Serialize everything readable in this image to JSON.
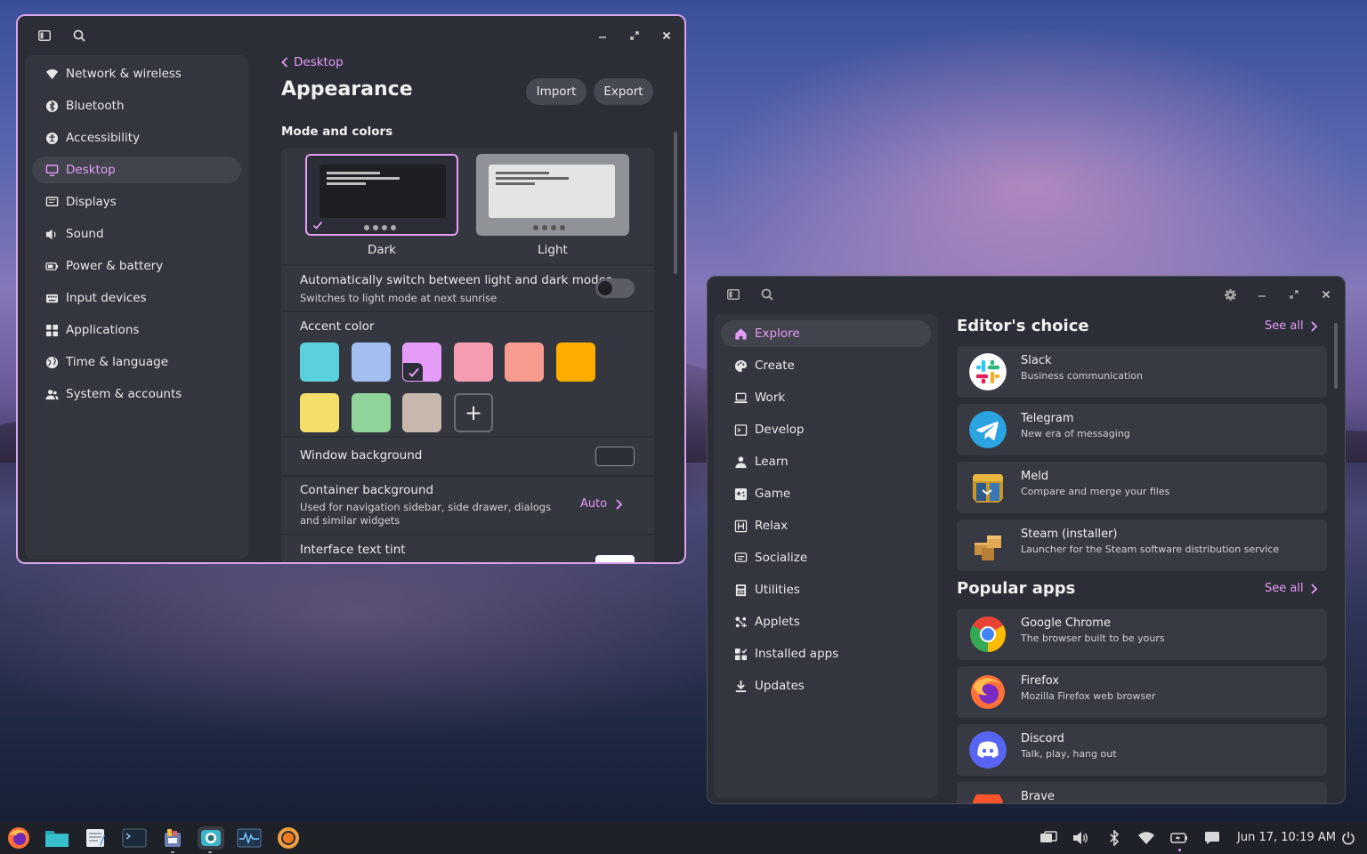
{
  "settings_window": {
    "sidebar": [
      {
        "label": "Network & wireless",
        "icon": "wifi-icon"
      },
      {
        "label": "Bluetooth",
        "icon": "bluetooth-icon"
      },
      {
        "label": "Accessibility",
        "icon": "accessibility-icon"
      },
      {
        "label": "Desktop",
        "icon": "desktop-icon",
        "active": true
      },
      {
        "label": "Displays",
        "icon": "displays-icon"
      },
      {
        "label": "Sound",
        "icon": "sound-icon"
      },
      {
        "label": "Power & battery",
        "icon": "battery-icon"
      },
      {
        "label": "Input devices",
        "icon": "keyboard-icon"
      },
      {
        "label": "Applications",
        "icon": "applications-icon"
      },
      {
        "label": "Time & language",
        "icon": "globe-icon"
      },
      {
        "label": "System & accounts",
        "icon": "accounts-icon"
      }
    ],
    "back_label": "Desktop",
    "title": "Appearance",
    "import_label": "Import",
    "export_label": "Export",
    "mode_section": "Mode and colors",
    "mode_dark_label": "Dark",
    "mode_light_label": "Light",
    "auto_switch_title": "Automatically switch between light and dark modes",
    "auto_switch_sub": "Switches to light mode at next sunrise",
    "accent_title": "Accent color",
    "accent_colors": [
      "#5ad1dc",
      "#a3bff0",
      "#e59cf7",
      "#f59cb0",
      "#f79b91",
      "#ffad00",
      "#f5df6a",
      "#90d49a",
      "#c7b8ad"
    ],
    "accent_selected_index": 2,
    "window_bg_title": "Window background",
    "container_bg_title": "Container background",
    "container_bg_sub": "Used for navigation sidebar, side drawer, dialogs and similar widgets",
    "container_bg_value": "Auto",
    "text_tint_title": "Interface text tint"
  },
  "store_window": {
    "sidebar": [
      {
        "label": "Explore",
        "icon": "home-icon",
        "active": true
      },
      {
        "label": "Create",
        "icon": "palette-icon"
      },
      {
        "label": "Work",
        "icon": "laptop-icon"
      },
      {
        "label": "Develop",
        "icon": "terminal-icon"
      },
      {
        "label": "Learn",
        "icon": "person-icon"
      },
      {
        "label": "Game",
        "icon": "gamepad-icon"
      },
      {
        "label": "Relax",
        "icon": "relax-icon"
      },
      {
        "label": "Socialize",
        "icon": "chat-icon"
      },
      {
        "label": "Utilities",
        "icon": "calculator-icon"
      },
      {
        "label": "Applets",
        "icon": "applets-icon"
      },
      {
        "label": "Installed apps",
        "icon": "installed-icon"
      },
      {
        "label": "Updates",
        "icon": "download-icon"
      }
    ],
    "editors_choice_title": "Editor's choice",
    "popular_title": "Popular apps",
    "see_all_label": "See all",
    "editors_choice": [
      {
        "name": "Slack",
        "desc": "Business communication",
        "icon": "slack-icon"
      },
      {
        "name": "Telegram",
        "desc": "New era of messaging",
        "icon": "telegram-icon"
      },
      {
        "name": "Meld",
        "desc": "Compare and merge your files",
        "icon": "meld-icon"
      },
      {
        "name": "Steam (installer)",
        "desc": "Launcher for the Steam software distribution service",
        "icon": "steam-icon"
      }
    ],
    "popular": [
      {
        "name": "Google Chrome",
        "desc": "The browser built to be yours",
        "icon": "chrome-icon"
      },
      {
        "name": "Firefox",
        "desc": "Mozilla Firefox web browser",
        "icon": "firefox-icon"
      },
      {
        "name": "Discord",
        "desc": "Talk, play, hang out",
        "icon": "discord-icon"
      },
      {
        "name": "Brave",
        "desc": "",
        "icon": "brave-icon"
      }
    ]
  },
  "taskbar": {
    "apps": [
      "firefox-icon",
      "files-icon",
      "text-editor-icon",
      "terminal-icon",
      "store-icon",
      "camera-icon",
      "system-monitor-icon",
      "music-icon"
    ],
    "clock": "Jun 17, 10:19 AM"
  }
}
